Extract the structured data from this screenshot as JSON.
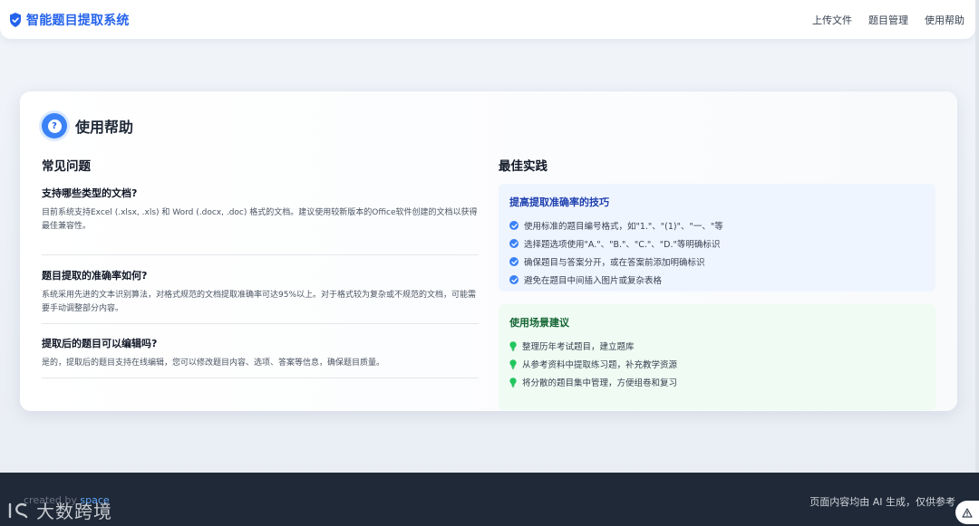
{
  "brand": {
    "title": "智能题目提取系统",
    "icon": "shield-check-icon",
    "accent": "#2563eb"
  },
  "nav": [
    "上传文件",
    "题目管理",
    "使用帮助"
  ],
  "card": {
    "title": "使用帮助",
    "icon": "question-circle-icon",
    "faq": {
      "title": "常见问题",
      "items": [
        {
          "q": "支持哪些类型的文档?",
          "a": "目前系统支持Excel (.xlsx, .xls) 和 Word (.docx, .doc) 格式的文档。建议使用较新版本的Office软件创建的文档以获得最佳兼容性。"
        },
        {
          "q": "题目提取的准确率如何?",
          "a": "系统采用先进的文本识别算法，对格式规范的文档提取准确率可达95%以上。对于格式较为复杂或不规范的文档，可能需要手动调整部分内容。"
        },
        {
          "q": "提取后的题目可以编辑吗?",
          "a": "是的，提取后的题目支持在线编辑，您可以修改题目内容、选项、答案等信息，确保题目质量。"
        }
      ]
    },
    "best": {
      "title": "最佳实践",
      "tips": {
        "title": "提高提取准确率的技巧",
        "items": [
          "使用标准的题目编号格式，如\"1.\"、\"(1)\"、\"一、\"等",
          "选择题选项使用\"A.\"、\"B.\"、\"C.\"、\"D.\"等明确标识",
          "确保题目与答案分开，或在答案前添加明确标识",
          "避免在题目中间插入图片或复杂表格"
        ]
      },
      "scenes": {
        "title": "使用场景建议",
        "items": [
          "整理历年考试题目，建立题库",
          "从参考资料中提取练习题，补充教学资源",
          "将分散的题目集中管理，方便组卷和复习"
        ]
      }
    }
  },
  "footer": {
    "created_prefix": "created by ",
    "created_link": "space",
    "watermark": "大数跨境",
    "notice": "页面内容均由 AI 生成，仅供参考"
  }
}
